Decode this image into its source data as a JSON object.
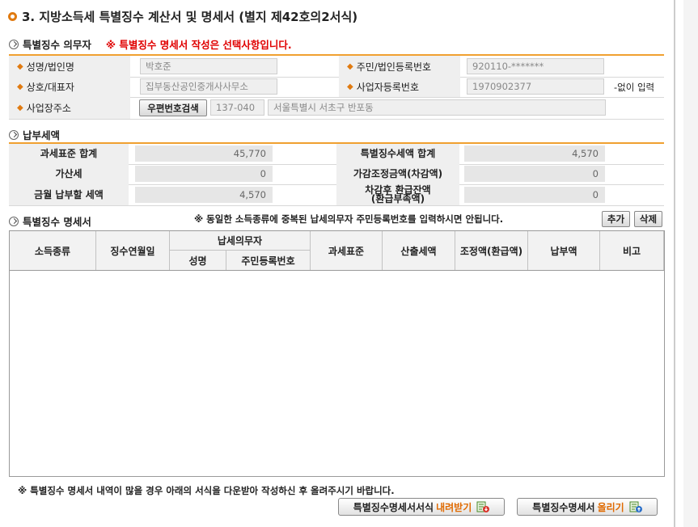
{
  "title": "3. 지방소득세 특별징수 계산서 및 명세서 (별지 제42호의2서식)",
  "sections": {
    "obligor": "특별징수 의무자",
    "obligor_notice": "※ 특별징수 명세서 작성은 선택사항입니다.",
    "payment": "납부세액",
    "details": "특별징수 명세서",
    "details_notice": "※ 동일한 소득종류에 중복된 납세의무자 주민등록번호를 입력하시면 안됩니다."
  },
  "obligor": {
    "name_label": "성명/법인명",
    "name_value": "박호준",
    "rrn_label": "주민/법인등록번호",
    "rrn_value": "920110-*******",
    "trade_label": "상호/대표자",
    "trade_value": "집부동산공인중개사사무소",
    "bizno_label": "사업자등록번호",
    "bizno_value": "1970902377",
    "bizno_hint": "-없이 입력",
    "addr_label": "사업장주소",
    "zip_button": "우편번호검색",
    "zip_value": "137-040",
    "addr_value": "서울특별시 서초구 반포동"
  },
  "payment": {
    "base_total_label": "과세표준 합계",
    "base_total_value": "45,770",
    "withheld_total_label": "특별징수세액 합계",
    "withheld_total_value": "4,570",
    "addtax_label": "가산세",
    "addtax_value": "0",
    "adjust_label": "가감조정금액(차감액)",
    "adjust_value": "0",
    "pay_label": "금월 납부할 세액",
    "pay_value": "4,570",
    "refund_label_1": "차감후 환급잔액",
    "refund_label_2": "(환급부족액)",
    "refund_value": "0"
  },
  "details": {
    "add_button": "추가",
    "delete_button": "삭제",
    "columns": {
      "income_type": "소득종류",
      "collect_month": "징수연월일",
      "taxpayer": "납세의무자",
      "taxpayer_name": "성명",
      "taxpayer_rrn": "주민등록번호",
      "tax_base": "과세표준",
      "calc_tax": "산출세액",
      "adjust": "조정액(환급액)",
      "paid": "납부액",
      "note": "비고"
    }
  },
  "footer": {
    "notice": "※ 특별징수 명세서 내역이 많을 경우 아래의 서식을 다운받아 작성하신 후 올려주시기 바랍니다.",
    "download_label": "특별징수명세서서식",
    "download_highlight": "내려받기",
    "upload_label": "특별징수명세서",
    "upload_highlight": "올리기"
  },
  "colors": {
    "accent": "#f0a030",
    "warning": "#e00000",
    "highlight": "#e06a00"
  }
}
